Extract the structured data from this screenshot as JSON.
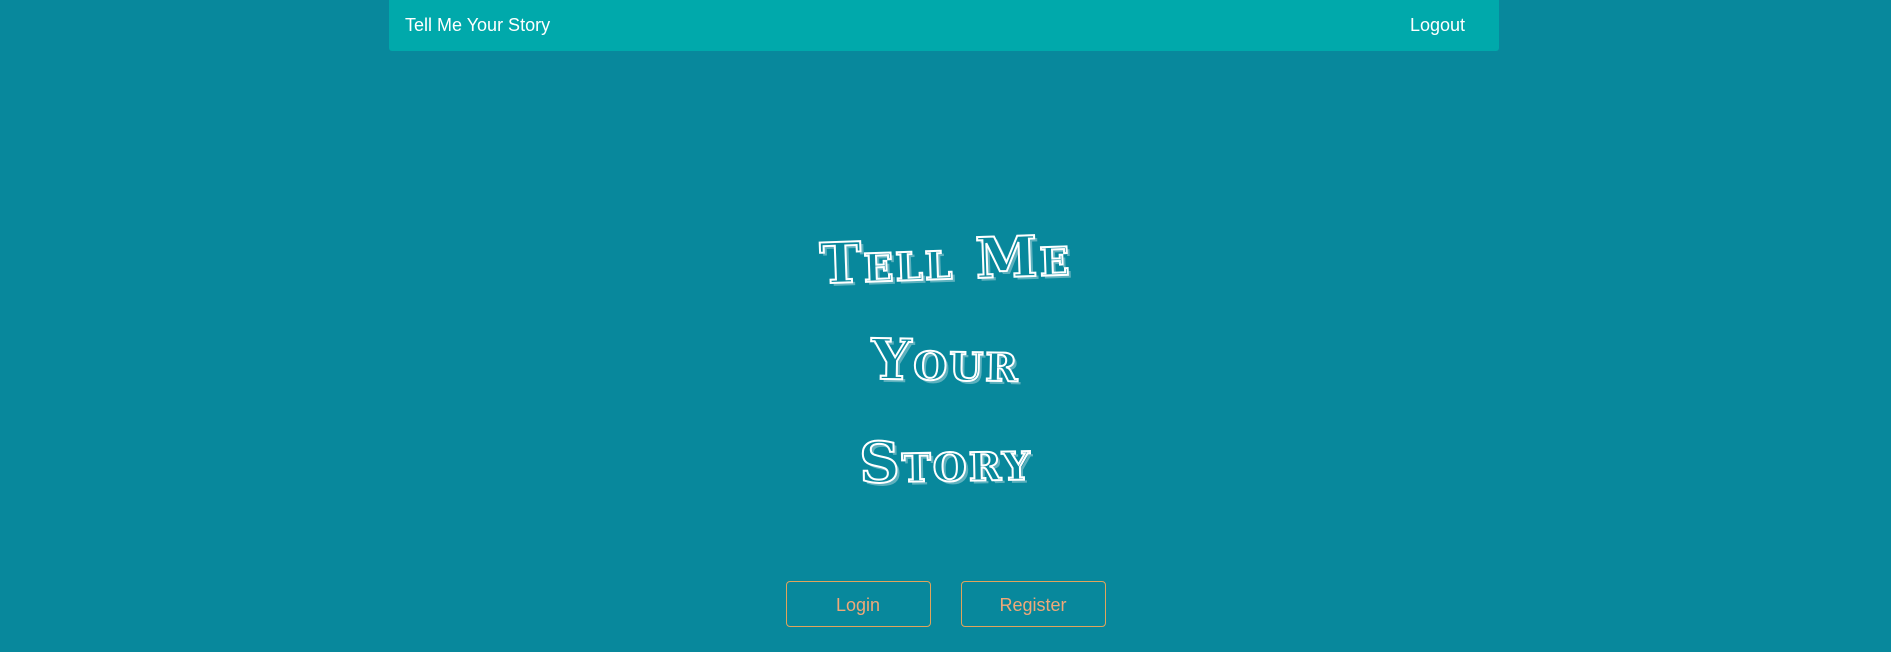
{
  "navbar": {
    "brand": "Tell Me Your Story",
    "logout_label": "Logout"
  },
  "hero": {
    "line1": "Tell Me",
    "line2": "Your",
    "line3": "Story"
  },
  "actions": {
    "login_label": "Login",
    "register_label": "Register"
  },
  "colors": {
    "background": "#08889c",
    "navbar": "#00a9ab",
    "button_accent": "#e0a45c"
  }
}
